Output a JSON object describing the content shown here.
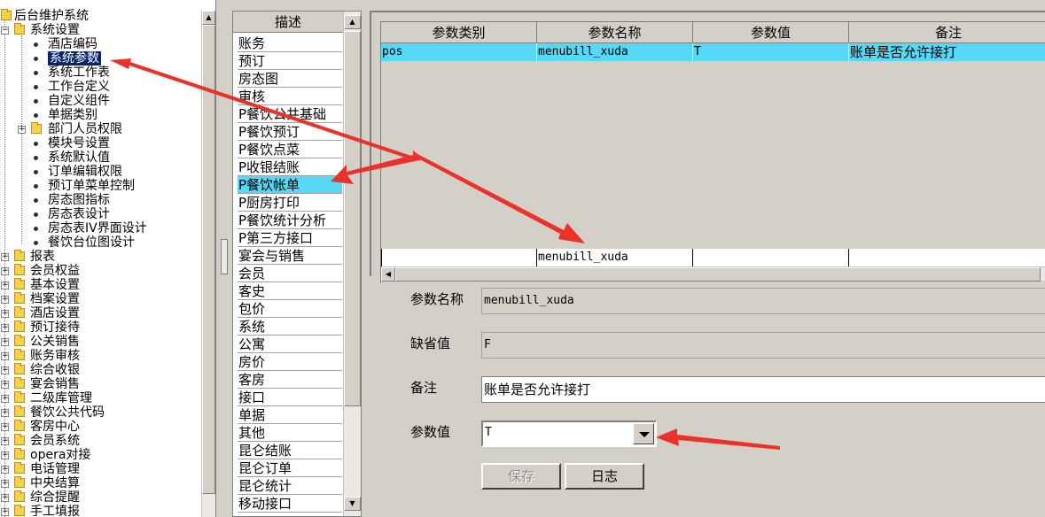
{
  "tree": {
    "root": "后台维护系统",
    "system_settings": {
      "label": "系统设置",
      "children": [
        "酒店编码",
        "系统参数",
        "系统工作表",
        "工作台定义",
        "自定义组件",
        "单据类别"
      ],
      "dept_perm": "部门人员权限",
      "children2": [
        "模块号设置",
        "系统默认值",
        "订单编辑权限",
        "预订单菜单控制",
        "房态图指标",
        "房态表设计",
        "房态表IV界面设计",
        "餐饮台位图设计"
      ]
    },
    "top_folders": [
      "报表",
      "会员权益",
      "基本设置",
      "档案设置",
      "酒店设置",
      "预订接待",
      "公关销售",
      "账务审核",
      "综合收银",
      "宴会销售",
      "二级库管理",
      "餐饮公共代码",
      "客房中心",
      "会员系统",
      "opera对接",
      "电话管理",
      "中央结算",
      "综合提醒",
      "手工填报"
    ]
  },
  "list": {
    "header": "描述",
    "items": [
      "账务",
      "预订",
      "房态图",
      "审核",
      "P餐饮公共基础",
      "P餐饮预订",
      "P餐饮点菜",
      "P收银结账",
      "P餐饮帐单",
      "P厨房打印",
      "P餐饮统计分析",
      "P第三方接口",
      "宴会与销售",
      "会员",
      "客史",
      "包价",
      "系统",
      "公寓",
      "房价",
      "客房",
      "接口",
      "单据",
      "其他",
      "昆仑结账",
      "昆仑订单",
      "昆仑统计",
      "移动接口"
    ],
    "selected_index": 8
  },
  "grid": {
    "columns": [
      "参数类别",
      "参数名称",
      "参数值",
      "备注"
    ],
    "rows": [
      {
        "category": "pos",
        "name": "menubill_xuda",
        "value": "T",
        "remark": "账单是否允许接打"
      }
    ],
    "edit_row": {
      "category": "",
      "name": "menubill_xuda",
      "value": "",
      "remark": ""
    }
  },
  "form": {
    "name_label": "参数名称",
    "name_value": "menubill_xuda",
    "default_label": "缺省值",
    "default_value": "F",
    "remark_label": "备注",
    "remark_value": "账单是否允许接打",
    "param_label": "参数值",
    "param_value": "T",
    "save_label": "保存",
    "log_label": "日志"
  },
  "colors": {
    "selection": "#57d8f5",
    "tree_selection": "#0a246a",
    "annotation_arrow": "#e8322a"
  }
}
